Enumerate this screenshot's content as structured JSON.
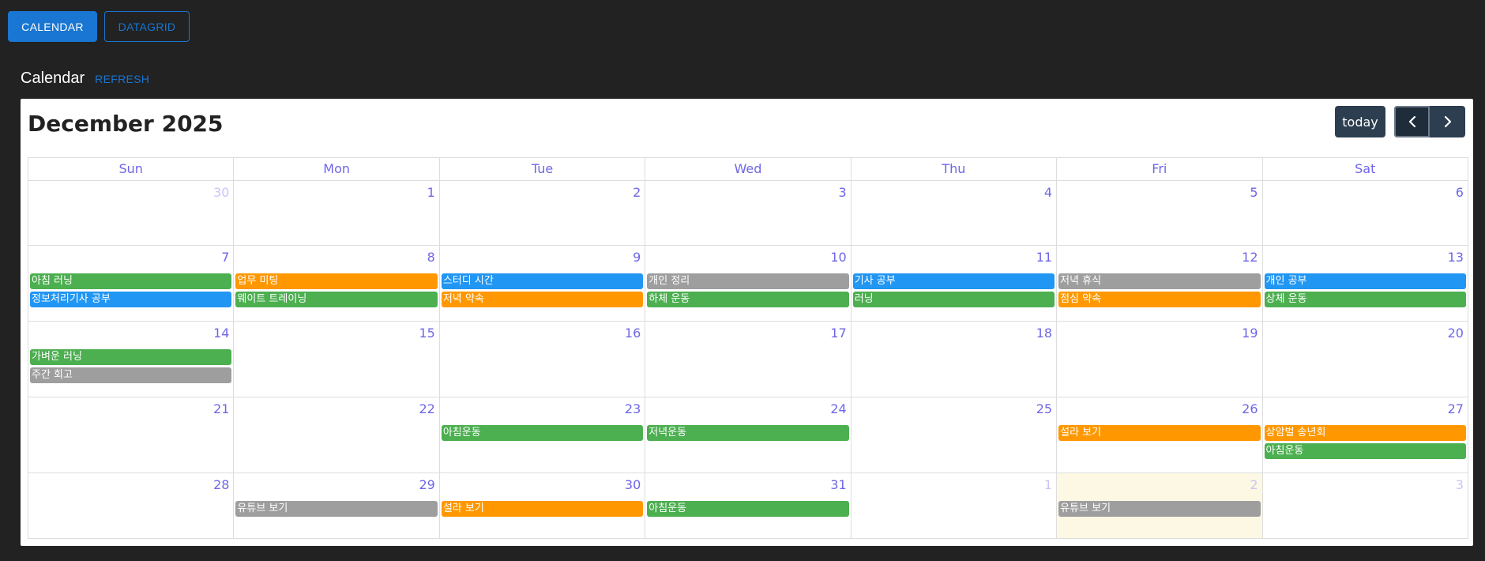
{
  "tabs": [
    {
      "label": "CALENDAR",
      "active": true
    },
    {
      "label": "DATAGRID",
      "active": false
    }
  ],
  "section": {
    "title": "Calendar",
    "refresh_label": "REFRESH"
  },
  "calendar": {
    "title": "December 2025",
    "today_label": "today",
    "prev_icon": "chevron-left-icon",
    "next_icon": "chevron-right-icon",
    "days_of_week": [
      "Sun",
      "Mon",
      "Tue",
      "Wed",
      "Thu",
      "Fri",
      "Sat"
    ],
    "colors": {
      "green": "#4caf50",
      "orange": "#ff9800",
      "blue": "#2196f3",
      "gray": "#9e9e9e",
      "today_bg": "#fcf8e3",
      "day_number": "#6e66e8"
    },
    "weeks": [
      [
        {
          "num": "30",
          "other": true,
          "events": []
        },
        {
          "num": "1",
          "events": []
        },
        {
          "num": "2",
          "events": []
        },
        {
          "num": "3",
          "events": []
        },
        {
          "num": "4",
          "events": []
        },
        {
          "num": "5",
          "events": []
        },
        {
          "num": "6",
          "events": []
        }
      ],
      [
        {
          "num": "7",
          "events": [
            {
              "title": "아침 러닝",
              "color": "green"
            },
            {
              "title": "정보처리기사 공부",
              "color": "blue"
            }
          ]
        },
        {
          "num": "8",
          "events": [
            {
              "title": "업무 미팅",
              "color": "orange"
            },
            {
              "title": "웨이트 트레이닝",
              "color": "green"
            }
          ]
        },
        {
          "num": "9",
          "events": [
            {
              "title": "스터디 시간",
              "color": "blue"
            },
            {
              "title": "저녁 약속",
              "color": "orange"
            }
          ]
        },
        {
          "num": "10",
          "events": [
            {
              "title": "개인 정리",
              "color": "gray"
            },
            {
              "title": "하체 운동",
              "color": "green"
            }
          ]
        },
        {
          "num": "11",
          "events": [
            {
              "title": "기사 공부",
              "color": "blue"
            },
            {
              "title": "러닝",
              "color": "green"
            }
          ]
        },
        {
          "num": "12",
          "events": [
            {
              "title": "저녁 휴식",
              "color": "gray"
            },
            {
              "title": "점심 약속",
              "color": "orange"
            }
          ]
        },
        {
          "num": "13",
          "events": [
            {
              "title": "개인 공부",
              "color": "blue"
            },
            {
              "title": "상체 운동",
              "color": "green"
            }
          ]
        }
      ],
      [
        {
          "num": "14",
          "events": [
            {
              "title": "가벼운 러닝",
              "color": "green"
            },
            {
              "title": "주간 회고",
              "color": "gray"
            }
          ]
        },
        {
          "num": "15",
          "events": []
        },
        {
          "num": "16",
          "events": []
        },
        {
          "num": "17",
          "events": []
        },
        {
          "num": "18",
          "events": []
        },
        {
          "num": "19",
          "events": []
        },
        {
          "num": "20",
          "events": []
        }
      ],
      [
        {
          "num": "21",
          "events": []
        },
        {
          "num": "22",
          "events": []
        },
        {
          "num": "23",
          "events": [
            {
              "title": "아침운동",
              "color": "green"
            }
          ]
        },
        {
          "num": "24",
          "events": [
            {
              "title": "저녁운동",
              "color": "green"
            }
          ]
        },
        {
          "num": "25",
          "events": []
        },
        {
          "num": "26",
          "events": [
            {
              "title": "설라 보기",
              "color": "orange"
            }
          ]
        },
        {
          "num": "27",
          "events": [
            {
              "title": "상암벌 송년회",
              "color": "orange"
            },
            {
              "title": "아침운동",
              "color": "green"
            }
          ]
        }
      ],
      [
        {
          "num": "28",
          "events": []
        },
        {
          "num": "29",
          "events": [
            {
              "title": "유튜브 보기",
              "color": "gray"
            }
          ]
        },
        {
          "num": "30",
          "events": [
            {
              "title": "설라 보기",
              "color": "orange"
            }
          ]
        },
        {
          "num": "31",
          "events": [
            {
              "title": "아침운동",
              "color": "green"
            }
          ]
        },
        {
          "num": "1",
          "other": true,
          "events": []
        },
        {
          "num": "2",
          "other": true,
          "today": true,
          "events": [
            {
              "title": "유튜브 보기",
              "color": "gray"
            }
          ]
        },
        {
          "num": "3",
          "other": true,
          "events": []
        }
      ]
    ]
  }
}
